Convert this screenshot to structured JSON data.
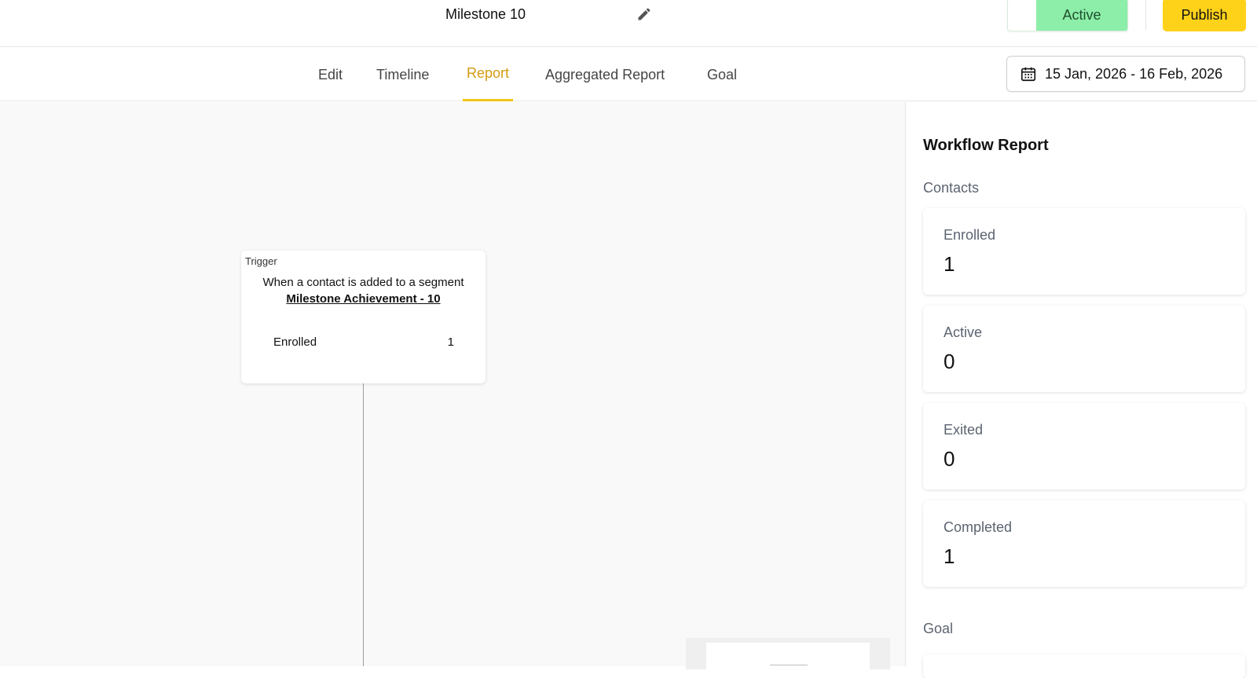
{
  "header": {
    "workflow_title": "Milestone 10",
    "status_label": "Active",
    "publish_label": "Publish"
  },
  "tabs": [
    {
      "label": "Edit",
      "active": false
    },
    {
      "label": "Timeline",
      "active": false
    },
    {
      "label": "Report",
      "active": true
    },
    {
      "label": "Aggregated Report",
      "active": false
    },
    {
      "label": "Goal",
      "active": false
    }
  ],
  "date_range": "15 Jan, 2026 - 16 Feb, 2026",
  "trigger_node": {
    "tag": "Trigger",
    "description": "When a contact is added to a segment",
    "segment": "Milestone Achievement - 10",
    "enrolled_label": "Enrolled",
    "enrolled_count": "1"
  },
  "report": {
    "title": "Workflow Report",
    "contacts_label": "Contacts",
    "stats": [
      {
        "label": "Enrolled",
        "value": "1"
      },
      {
        "label": "Active",
        "value": "0"
      },
      {
        "label": "Exited",
        "value": "0"
      },
      {
        "label": "Completed",
        "value": "1"
      }
    ],
    "goal_label": "Goal"
  },
  "colors": {
    "accent_tab": "#d29b12",
    "tab_underline": "#f5c518",
    "status_bg": "#8ceea8",
    "publish_bg": "#ffd21a"
  },
  "icons": {
    "edit_title": "pencil-icon",
    "date_range": "calendar-icon"
  }
}
